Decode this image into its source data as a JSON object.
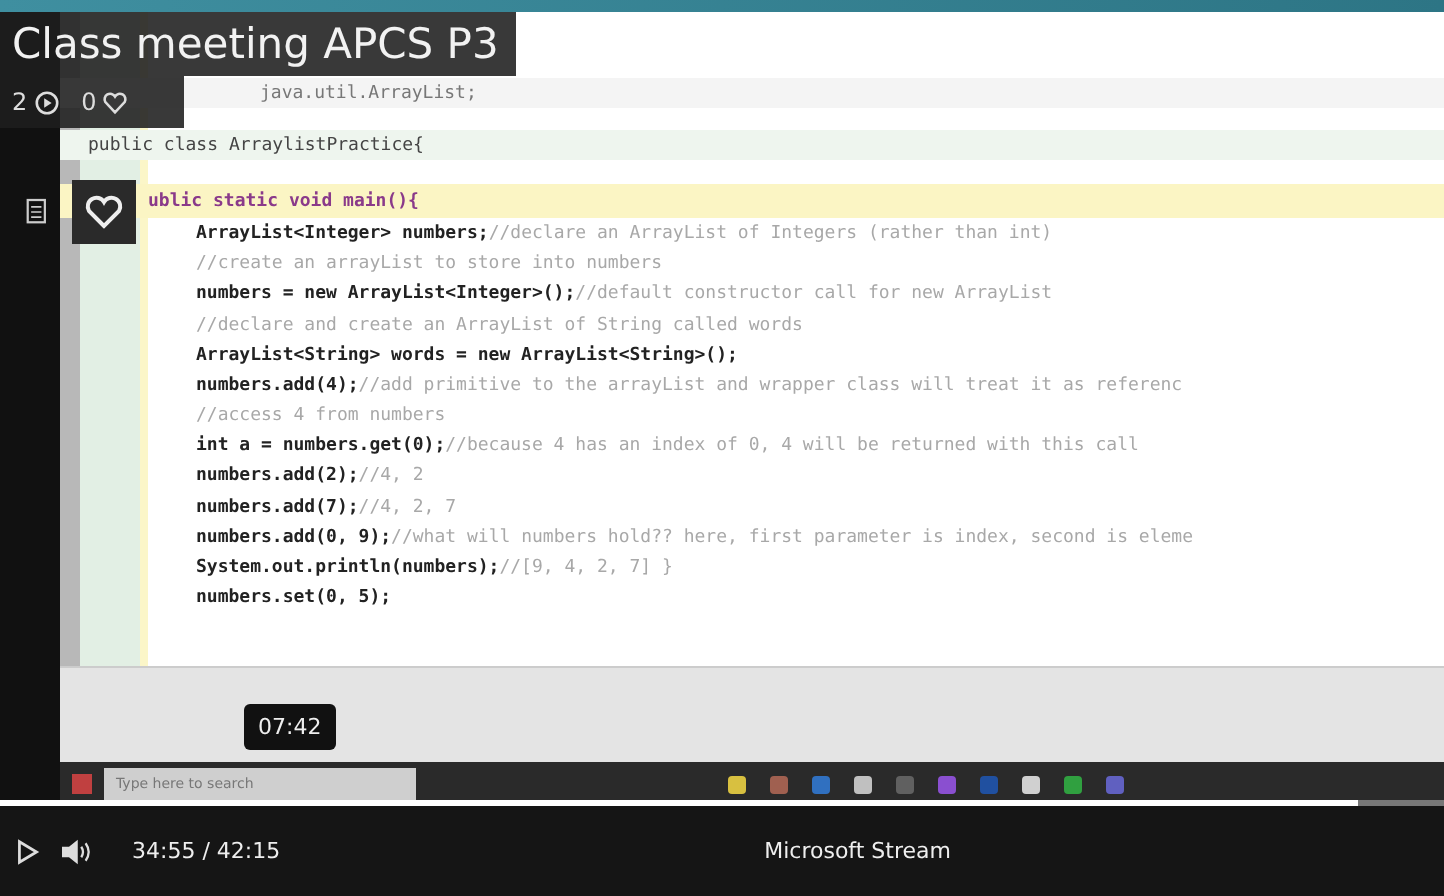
{
  "title": "Class meeting APCS P3",
  "stats": {
    "views": "2",
    "likes": "0"
  },
  "editor": {
    "lines": [
      {
        "kind": "plain",
        "code": "java.util.ArrayList;"
      },
      {
        "kind": "class",
        "code": "public class ArraylistPractice{"
      },
      {
        "kind": "current",
        "code": "ublic static void main(){"
      },
      {
        "kind": "body",
        "code": "ArrayList<Integer> numbers;",
        "comment": "//declare an ArrayList of Integers (rather than int)"
      },
      {
        "kind": "body",
        "comment": "//create an arrayList to store into numbers"
      },
      {
        "kind": "body",
        "code": "numbers = new ArrayList<Integer>();",
        "comment": "//default constructor call for new ArrayList"
      },
      {
        "kind": "body",
        "comment": "//declare and create an ArrayList of String called words"
      },
      {
        "kind": "body",
        "code": "ArrayList<String> words = new ArrayList<String>();"
      },
      {
        "kind": "body",
        "code": "numbers.add(4);",
        "comment": "//add primitive to the arrayList and wrapper class will treat it as referenc"
      },
      {
        "kind": "body",
        "comment": "//access 4 from numbers"
      },
      {
        "kind": "body",
        "code": "int a = numbers.get(0);",
        "comment": "//because 4 has an index of 0, 4 will be returned with this call"
      },
      {
        "kind": "body",
        "code": "numbers.add(2);",
        "comment": "//4, 2"
      },
      {
        "kind": "body",
        "code": "numbers.add(7);",
        "comment": "//4, 2, 7"
      },
      {
        "kind": "body",
        "code": "numbers.add(0, 9);",
        "comment": "//what will numbers hold?? here, first parameter is index, second is eleme"
      },
      {
        "kind": "body",
        "code": "System.out.println(numbers);",
        "comment": "//[9, 4, 2, 7]  }"
      },
      {
        "kind": "body",
        "code": "numbers.set(0, 5);"
      }
    ]
  },
  "tooltip": "07:42",
  "taskbar": {
    "search_placeholder": "Type here to search",
    "icons": [
      {
        "color": "#d8c040"
      },
      {
        "color": "#a06050"
      },
      {
        "color": "#3070c0"
      },
      {
        "color": "#c0c0c0"
      },
      {
        "color": "#606060"
      },
      {
        "color": "#8a4fd0"
      },
      {
        "color": "#2050a0"
      },
      {
        "color": "#d0d0d0"
      },
      {
        "color": "#30a040"
      },
      {
        "color": "#6060c0"
      }
    ]
  },
  "player": {
    "level": 0.94,
    "time": "34:55 / 42:15",
    "brand": "Microsoft Stream"
  }
}
